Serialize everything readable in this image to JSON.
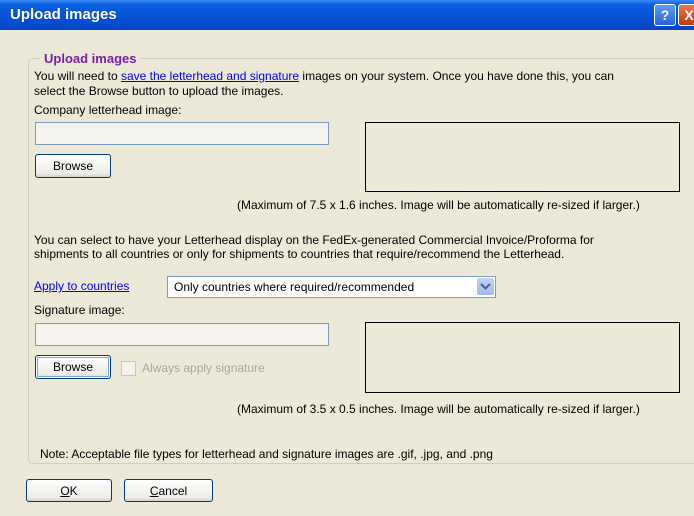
{
  "window": {
    "title": "Upload images",
    "help_glyph": "?",
    "close_glyph": "X"
  },
  "group": {
    "title": "Upload images"
  },
  "intro": {
    "part1": "You will need to ",
    "link": "save the letterhead and signature",
    "part2": " images on your system.  Once you have done this, you can",
    "line2": "select the Browse button to upload the images."
  },
  "letterhead": {
    "label": "Company letterhead image:",
    "path_value": "",
    "browse_label": "Browse",
    "size_note": "(Maximum of 7.5 x 1.6 inches.  Image will be automatically re-sized if larger.)"
  },
  "countries": {
    "info_line1": "You can select to have your Letterhead display on the FedEx-generated Commercial Invoice/Proforma for",
    "info_line2": "shipments to all countries or only for shipments to countries that require/recommend the Letterhead.",
    "apply_link": "Apply to countries",
    "select_value": "Only countries where required/recommended"
  },
  "signature": {
    "label": "Signature image:",
    "path_value": "",
    "browse_label": "Browse",
    "always_apply_label": "Always apply signature",
    "always_apply_checked": false,
    "size_note": "(Maximum of 3.5 x 0.5 inches.  Image will be automatically re-sized if larger.)"
  },
  "note": "Note:  Acceptable file types for letterhead and signature images are .gif, .jpg, and .png",
  "buttons": {
    "ok_mnemonic": "O",
    "ok_rest": "K",
    "cancel_mnemonic": "C",
    "cancel_rest": "ancel"
  }
}
